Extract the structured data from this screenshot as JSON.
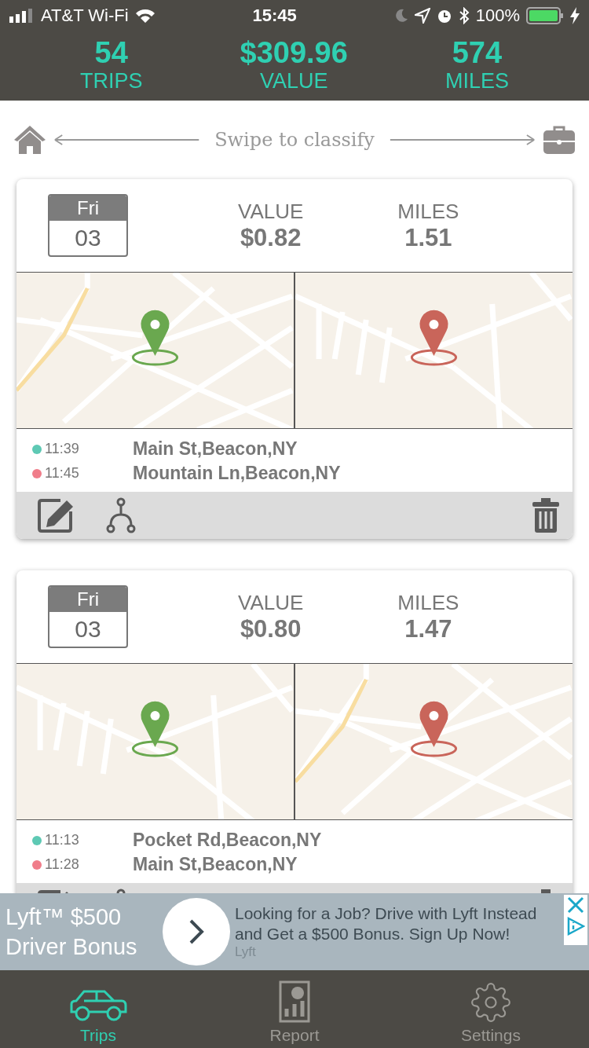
{
  "status_bar": {
    "carrier": "AT&T Wi-Fi",
    "time": "15:45",
    "battery": "100%"
  },
  "summary": [
    {
      "value": "54",
      "label": "TRIPS"
    },
    {
      "value": "$309.96",
      "label": "VALUE"
    },
    {
      "value": "574",
      "label": "MILES"
    }
  ],
  "swipe_hint": "Swipe to classify",
  "trips": [
    {
      "day": "Fri",
      "date": "03",
      "value_label": "VALUE",
      "value": "$0.82",
      "miles_label": "MILES",
      "miles": "1.51",
      "stops": [
        {
          "time": "11:39",
          "place": "Main St,Beacon,NY",
          "color": "#5ec9b4"
        },
        {
          "time": "11:45",
          "place": "Mountain Ln,Beacon,NY",
          "color": "#f07d8a"
        }
      ]
    },
    {
      "day": "Fri",
      "date": "03",
      "value_label": "VALUE",
      "value": "$0.80",
      "miles_label": "MILES",
      "miles": "1.47",
      "stops": [
        {
          "time": "11:13",
          "place": "Pocket Rd,Beacon,NY",
          "color": "#5ec9b4"
        },
        {
          "time": "11:28",
          "place": "Main St,Beacon,NY",
          "color": "#f07d8a"
        }
      ]
    }
  ],
  "ad": {
    "headline": "Lyft™ $500 Driver Bonus",
    "body": "Looking for a Job? Drive with Lyft Instead and Get a $500 Bonus. Sign Up Now!",
    "advertiser": "Lyft"
  },
  "tabs": [
    {
      "label": "Trips",
      "selected": true,
      "kind": "car"
    },
    {
      "label": "Report",
      "selected": false,
      "kind": "report"
    },
    {
      "label": "Settings",
      "selected": false,
      "kind": "gear"
    }
  ]
}
